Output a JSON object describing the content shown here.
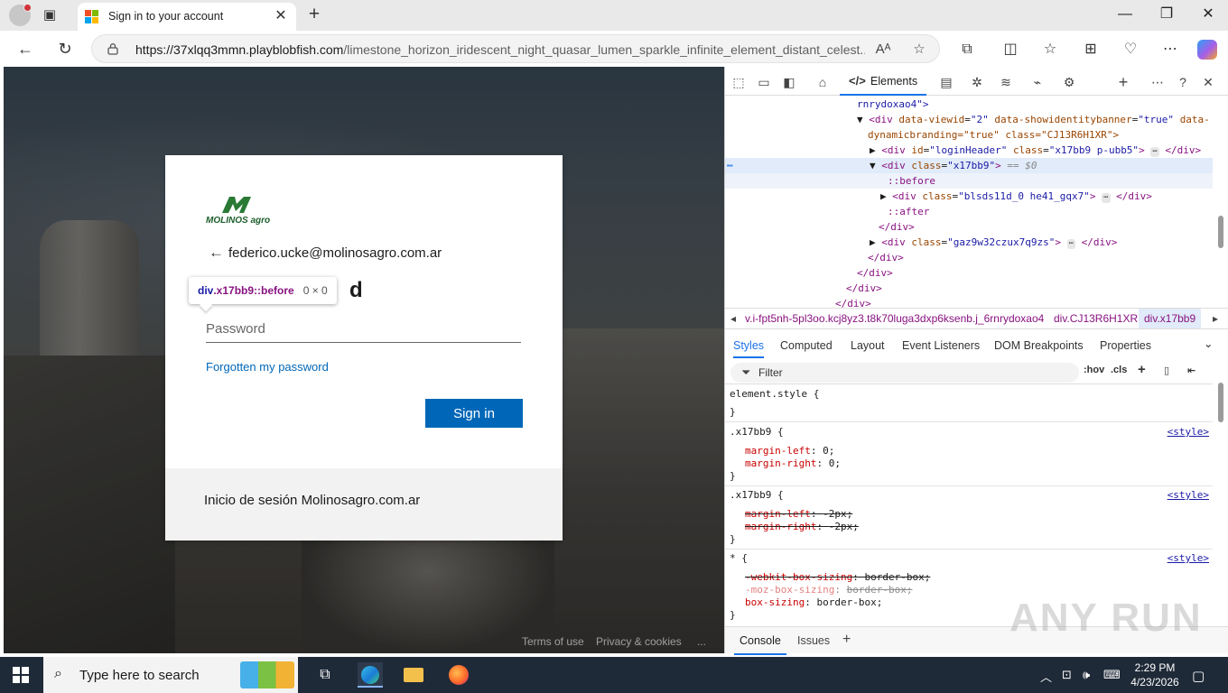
{
  "browser": {
    "tab": {
      "title": "Sign in to your account"
    },
    "address": {
      "url_host": "https://37xlqq3mmn.playblobfish.com",
      "url_path": "/limestone_horizon_iridescent_night_quasar_lumen_sparkle_infinite_element_distant_celest..."
    }
  },
  "login": {
    "logo_text": "MOLINOS agro",
    "identity": "federico.ucke@molinosagro.com.ar",
    "heading_tail": "d",
    "password_placeholder": "Password",
    "forgot_link": "Forgotten my password",
    "sign_in_button": "Sign in",
    "footer_text": "Inicio de sesión Molinosagro.com.ar",
    "page_footer": {
      "terms": "Terms of use",
      "privacy": "Privacy & cookies",
      "more": "..."
    }
  },
  "tooltip": {
    "selector_tag": "div",
    "selector_class": ".x17bb9::before",
    "size": "0 × 0"
  },
  "devtools": {
    "active_tab": "Elements",
    "dom": {
      "l1": "rnrydoxao4\">",
      "l2_attrs": [
        "data-viewid",
        "\"2\"",
        "data-showidentitybanner",
        "\"true\"",
        "data-"
      ],
      "l3": "dynamicbranding=\"true\" class=\"CJ13R6H1XR\">",
      "l4_id": "\"loginHeader\"",
      "l4_class": "\"x17bb9 p-ubb5\"",
      "l5_class": "\"x17bb9\"",
      "l5_eq": "== $0",
      "before": "::before",
      "l7_class": "\"blsds11d_0 he41_gqx7\"",
      "after": "::after",
      "l10_class": "\"gaz9w32czux7q9zs\"",
      "close_div": "</div>"
    },
    "breadcrumbs": [
      "v.i-fpt5nh-5pl3oo.kcj8yz3.t8k70luga3dxp6ksenb.j_6rnrydoxao4",
      "div.CJ13R6H1XR",
      "div.x17bb9"
    ],
    "style_tabs": [
      "Styles",
      "Computed",
      "Layout",
      "Event Listeners",
      "DOM Breakpoints",
      "Properties"
    ],
    "filter_label": "Filter",
    "filter_buttons": [
      ":hov",
      ".cls"
    ],
    "rules": {
      "element_style": "element.style {",
      "close": "}",
      "selector": ".x17bb9 {",
      "universal": "* {",
      "source": "<style>",
      "ml": "margin-left",
      "mr": "margin-right",
      "ml_val": "0;",
      "mr_val": "0;",
      "neg_val": "-2px;",
      "wbs": "-webkit-box-sizing",
      "mbs": "-moz-box-sizing",
      "bs": "box-sizing",
      "bb_val": "border-box;"
    },
    "drawer_tabs": [
      "Console",
      "Issues"
    ]
  },
  "taskbar": {
    "search_placeholder": "Type here to search",
    "time": "2:29 PM",
    "date": "4/23/2026"
  },
  "watermark": "ANY RUN",
  "colors": {
    "accent": "#0067b8",
    "devtools_blue": "#1a73e8",
    "taskbar": "#1f2a38"
  }
}
